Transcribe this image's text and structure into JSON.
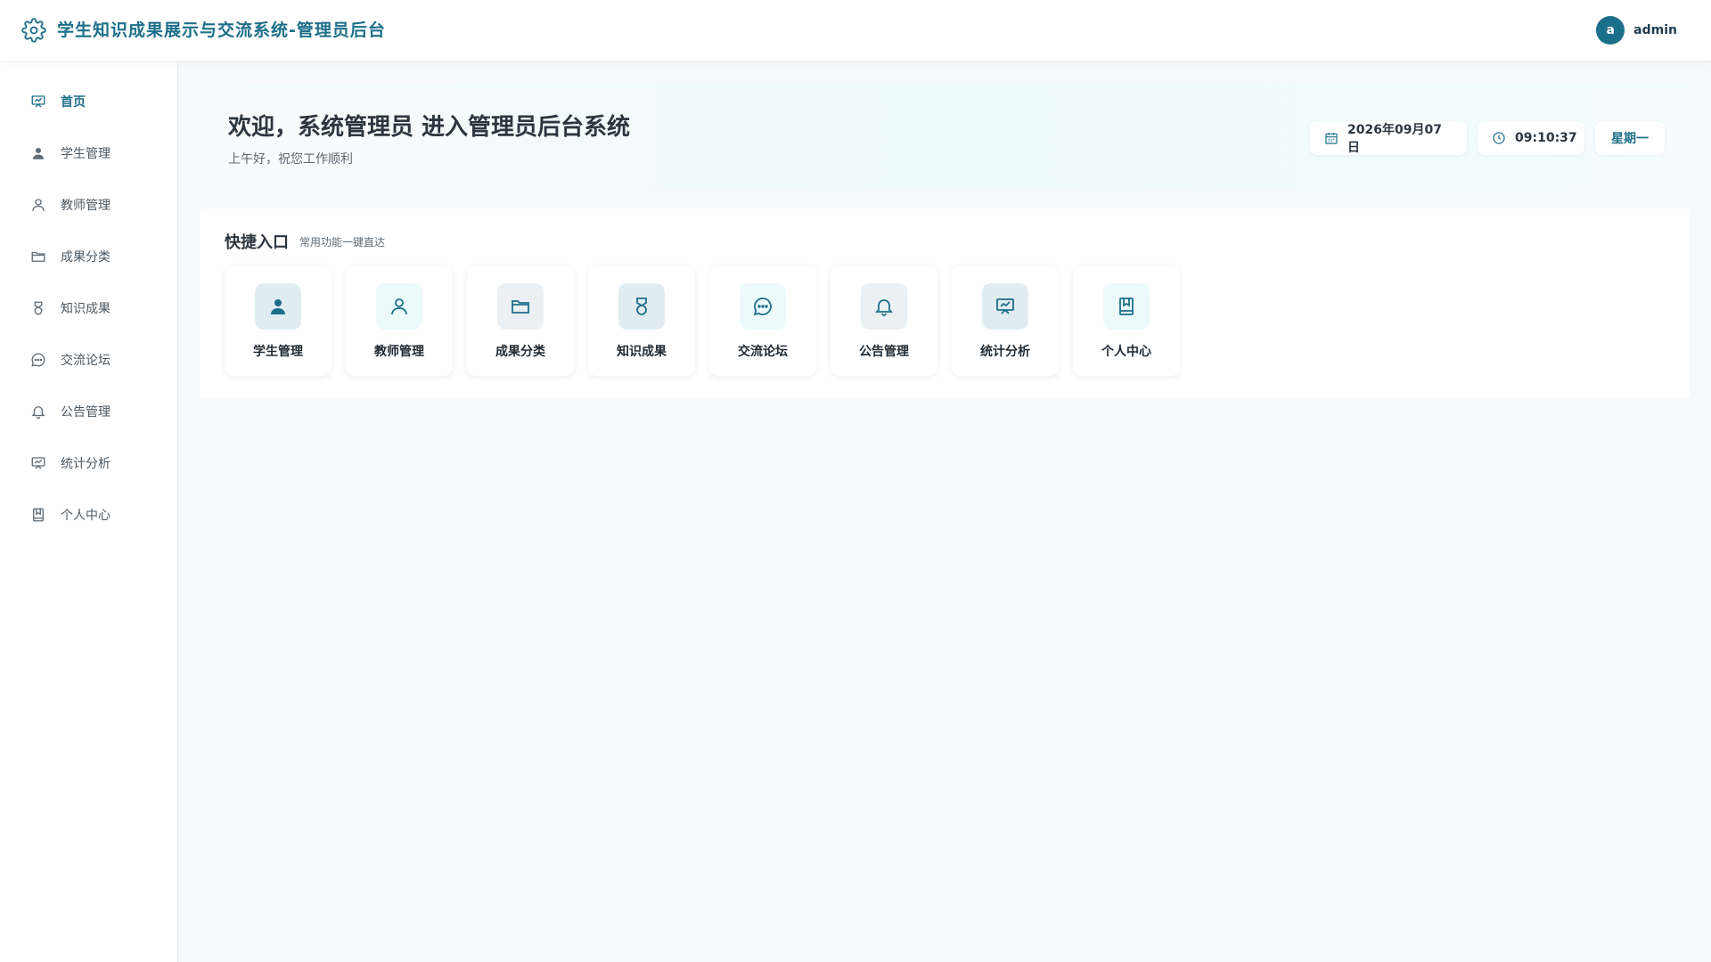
{
  "header": {
    "title": "学生知识成果展示与交流系统-管理员后台",
    "user_initial": "a",
    "username": "admin",
    "logo_icon": "gear-icon"
  },
  "sidebar": {
    "items": [
      {
        "label": "首页",
        "icon": "presentation-icon",
        "active": true
      },
      {
        "label": "学生管理",
        "icon": "user-filled-icon"
      },
      {
        "label": "教师管理",
        "icon": "user-outline-icon"
      },
      {
        "label": "成果分类",
        "icon": "folder-icon"
      },
      {
        "label": "知识成果",
        "icon": "medal-icon"
      },
      {
        "label": "交流论坛",
        "icon": "chat-icon"
      },
      {
        "label": "公告管理",
        "icon": "bell-icon"
      },
      {
        "label": "统计分析",
        "icon": "chart-board-icon"
      },
      {
        "label": "个人中心",
        "icon": "book-icon"
      }
    ]
  },
  "banner": {
    "welcome": "欢迎，系统管理员 进入管理员后台系统",
    "greeting": "上午好，祝您工作顺利",
    "date": "2026年09月07日",
    "time": "09:10:37",
    "weekday": "星期一"
  },
  "quick": {
    "title": "快捷入口",
    "subtitle": "常用功能一键直达",
    "items": [
      {
        "label": "学生管理",
        "icon": "user-filled-icon",
        "bg": "#e0ecf1"
      },
      {
        "label": "教师管理",
        "icon": "user-outline-icon",
        "bg": "#ecfafc"
      },
      {
        "label": "成果分类",
        "icon": "folder-icon",
        "bg": "#eaf0f3"
      },
      {
        "label": "知识成果",
        "icon": "medal-icon",
        "bg": "#e0ecf1"
      },
      {
        "label": "交流论坛",
        "icon": "chat-icon",
        "bg": "#ecfafc"
      },
      {
        "label": "公告管理",
        "icon": "bell-icon",
        "bg": "#eaf0f3"
      },
      {
        "label": "统计分析",
        "icon": "chart-board-icon",
        "bg": "#e0ecf1"
      },
      {
        "label": "个人中心",
        "icon": "book-icon",
        "bg": "#ecfafc"
      }
    ]
  },
  "colors": {
    "accent": "#1c6f8a",
    "page_bg": "#f7f9fb"
  }
}
